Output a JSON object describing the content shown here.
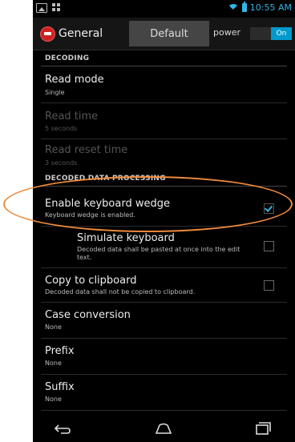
{
  "status_bar": {
    "time": "10:55 AM"
  },
  "action_bar": {
    "title": "General",
    "tab_label": "Default",
    "power_label": "power",
    "toggle_label": "On"
  },
  "sections": {
    "decoding": "DECODING",
    "decoded_data_processing": "DECODED DATA PROCESSING"
  },
  "items": {
    "read_mode": {
      "title": "Read mode",
      "summary": "Single"
    },
    "read_time": {
      "title": "Read time",
      "summary": "5 seconds"
    },
    "read_reset_time": {
      "title": "Read reset time",
      "summary": "3 seconds"
    },
    "keyboard_wedge": {
      "title": "Enable keyboard wedge",
      "summary": "Keyboard wedge is enabled.",
      "checked": true
    },
    "simulate_keyboard": {
      "title": "Simulate keyboard",
      "summary": "Decoded data shall be pasted at once into the edit text.",
      "checked": false
    },
    "copy_clipboard": {
      "title": "Copy to clipboard",
      "summary": "Decoded data shall not be copied to clipboard.",
      "checked": false
    },
    "case_conversion": {
      "title": "Case conversion",
      "summary": "None"
    },
    "prefix": {
      "title": "Prefix",
      "summary": "None"
    },
    "suffix": {
      "title": "Suffix",
      "summary": "None"
    }
  },
  "colors": {
    "accent": "#33b5e5",
    "highlight": "#f08a3c"
  },
  "nav_icons": [
    "back-icon",
    "home-icon",
    "recent-apps-icon"
  ]
}
